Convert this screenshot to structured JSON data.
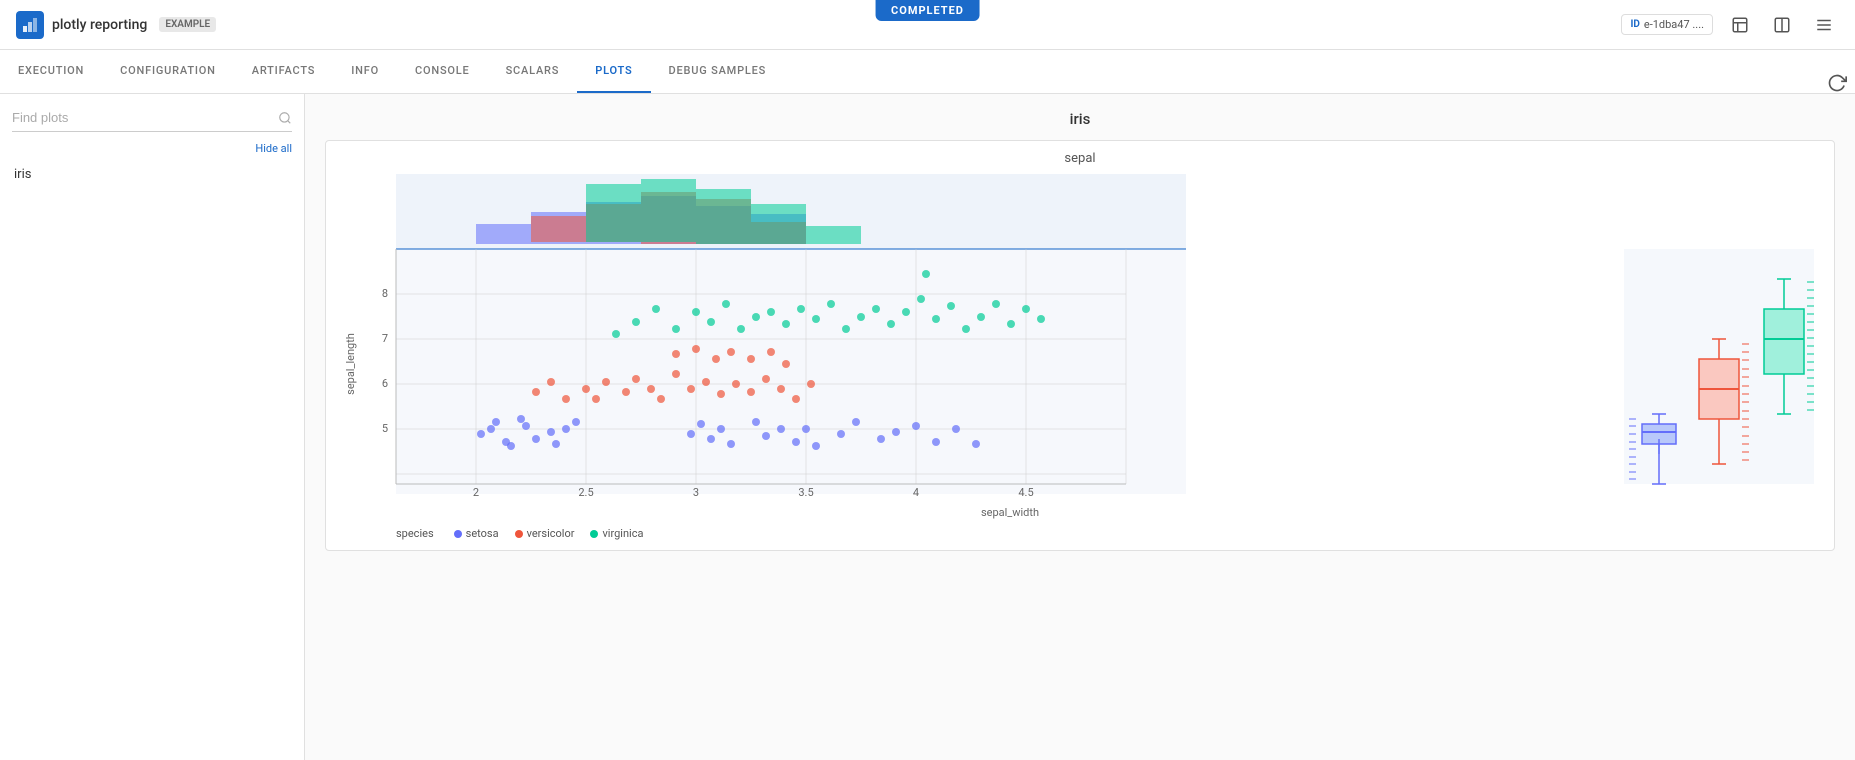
{
  "app": {
    "title": "plotly reporting",
    "badge": "EXAMPLE",
    "completed_label": "COMPLETED",
    "id_label": "ID",
    "id_value": "e-1dba47 ...."
  },
  "nav": {
    "tabs": [
      {
        "label": "EXECUTION",
        "active": false
      },
      {
        "label": "CONFIGURATION",
        "active": false
      },
      {
        "label": "ARTIFACTS",
        "active": false
      },
      {
        "label": "INFO",
        "active": false
      },
      {
        "label": "CONSOLE",
        "active": false
      },
      {
        "label": "SCALARS",
        "active": false
      },
      {
        "label": "PLOTS",
        "active": true
      },
      {
        "label": "DEBUG SAMPLES",
        "active": false
      }
    ]
  },
  "sidebar": {
    "search_placeholder": "Find plots",
    "hide_all_label": "Hide all",
    "items": [
      {
        "label": "iris"
      }
    ]
  },
  "plot": {
    "section_title": "iris",
    "sub_title": "sepal",
    "x_axis_label": "sepal_width",
    "y_axis_label": "sepal_length",
    "legend": {
      "species_label": "species",
      "items": [
        {
          "name": "setosa",
          "color": "#636efa"
        },
        {
          "name": "versicolor",
          "color": "#ef553b"
        },
        {
          "name": "virginica",
          "color": "#00cc96"
        }
      ]
    }
  },
  "icons": {
    "logo": "📊",
    "search": "🔍",
    "id": "ID",
    "notes": "📋",
    "split": "⊟",
    "menu": "☰",
    "refresh": "🔄"
  }
}
